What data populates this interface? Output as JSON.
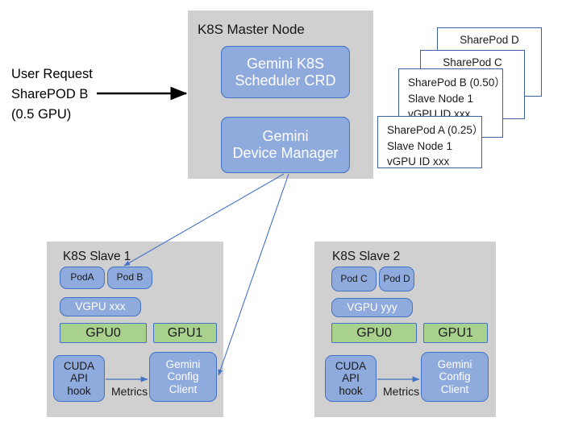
{
  "request": {
    "line1": "User Request",
    "line2": "SharePOD B",
    "line3": "(0.5 GPU)",
    "arrow_name": "request-arrow"
  },
  "master": {
    "title": "K8S Master Node",
    "components": [
      {
        "id": "scheduler",
        "line1": "Gemini K8S",
        "line2": "Scheduler CRD"
      },
      {
        "id": "device_manager",
        "line1": "Gemini",
        "line2": "Device Manager"
      }
    ]
  },
  "sharepods": [
    {
      "id": "d",
      "title": "SharePod D",
      "kind": "title"
    },
    {
      "id": "c",
      "title": "SharePod C",
      "kind": "title"
    },
    {
      "id": "b",
      "kind": "detail",
      "line1": "SharePod B (0.50）",
      "line2": "Slave Node 1",
      "line3": "vGPU ID xxx"
    },
    {
      "id": "a",
      "kind": "detail",
      "line1": "SharePod A (0.25）",
      "line2": "Slave Node 1",
      "line3": "vGPU ID xxx"
    }
  ],
  "slaves": [
    {
      "id": "slave1",
      "title": "K8S Slave 1",
      "pods": [
        {
          "id": "podA",
          "label": "PodA"
        },
        {
          "id": "podB",
          "label": "Pod B"
        }
      ],
      "vgpu": "VGPU xxx",
      "gpus": [
        {
          "id": "gpu0",
          "label": "GPU0"
        },
        {
          "id": "gpu1",
          "label": "GPU1"
        }
      ],
      "hook": {
        "line1": "CUDA",
        "line2": "API",
        "line3": "hook"
      },
      "metrics_label": "Metrics",
      "config_client": {
        "line1": "Gemini",
        "line2": "Config",
        "line3": "Client"
      }
    },
    {
      "id": "slave2",
      "title": "K8S Slave 2",
      "pods": [
        {
          "id": "podC",
          "label": "Pod C"
        },
        {
          "id": "podD",
          "label": "Pod D"
        }
      ],
      "vgpu": "VGPU yyy",
      "gpus": [
        {
          "id": "gpu0",
          "label": "GPU0"
        },
        {
          "id": "gpu1",
          "label": "GPU1"
        }
      ],
      "hook": {
        "line1": "CUDA",
        "line2": "API",
        "line3": "hook"
      },
      "metrics_label": "Metrics",
      "config_client": {
        "line1": "Gemini",
        "line2": "Config",
        "line3": "Client"
      }
    }
  ],
  "colors": {
    "panel_gray": "#D0D0D0",
    "box_blue_fill": "#8FAADC",
    "box_blue_border": "#4472C4",
    "box_green_fill": "#A9D18E",
    "card_border": "#3B62A8",
    "connector_blue": "#4472C4",
    "arrow_black": "#000000"
  }
}
